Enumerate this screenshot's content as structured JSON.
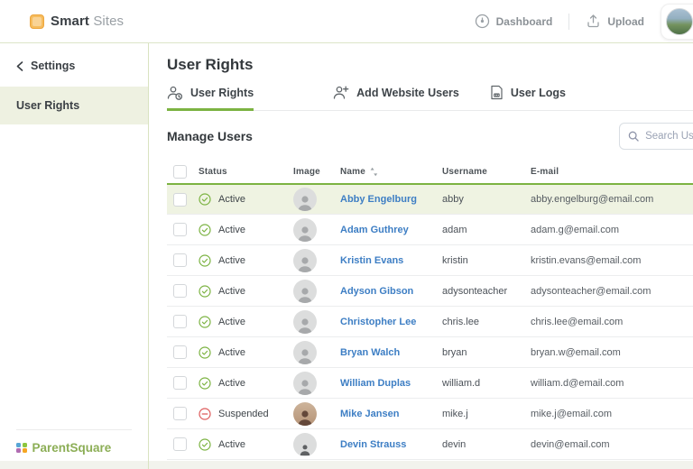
{
  "colors": {
    "accent_green": "#7cb342",
    "link_blue": "#3d7ec4",
    "suspended_red": "#dd5b5b",
    "brand_orange": "#f6bc5d",
    "parentsquare_green": "#8cae56",
    "selected_row_bg": "#eff3e2"
  },
  "topbar": {
    "brand_bold": "Smart",
    "brand_light": "Sites",
    "dashboard_label": "Dashboard",
    "upload_label": "Upload"
  },
  "sidebar": {
    "back_label": "Settings",
    "items": [
      {
        "label": "User Rights",
        "active": true
      }
    ],
    "footer_brand": "ParentSquare"
  },
  "main": {
    "page_title": "User Rights",
    "tabs": [
      {
        "label": "User Rights",
        "active": true
      },
      {
        "label": "Add Website Users",
        "active": false
      },
      {
        "label": "User Logs",
        "active": false
      }
    ],
    "section_title": "Manage Users",
    "search_placeholder": "Search User",
    "table": {
      "columns": [
        "Status",
        "Image",
        "Name",
        "Username",
        "E-mail"
      ],
      "rows": [
        {
          "selected": true,
          "status": "Active",
          "status_type": "active",
          "name": "Abby Engelburg",
          "username": "abby",
          "email": "abby.engelburg@email.com",
          "avatar": "gray"
        },
        {
          "selected": false,
          "status": "Active",
          "status_type": "active",
          "name": "Adam Guthrey",
          "username": "adam",
          "email": "adam.g@email.com",
          "avatar": "gray"
        },
        {
          "selected": false,
          "status": "Active",
          "status_type": "active",
          "name": "Kristin Evans",
          "username": "kristin",
          "email": "kristin.evans@email.com",
          "avatar": "gray"
        },
        {
          "selected": false,
          "status": "Active",
          "status_type": "active",
          "name": "Adyson Gibson",
          "username": "adysonteacher",
          "email": "adysonteacher@email.com",
          "avatar": "gray"
        },
        {
          "selected": false,
          "status": "Active",
          "status_type": "active",
          "name": "Christopher Lee",
          "username": "chris.lee",
          "email": "chris.lee@email.com",
          "avatar": "gray"
        },
        {
          "selected": false,
          "status": "Active",
          "status_type": "active",
          "name": "Bryan Walch",
          "username": "bryan",
          "email": "bryan.w@email.com",
          "avatar": "gray"
        },
        {
          "selected": false,
          "status": "Active",
          "status_type": "active",
          "name": "William Duplas",
          "username": "william.d",
          "email": "william.d@email.com",
          "avatar": "gray"
        },
        {
          "selected": false,
          "status": "Suspended",
          "status_type": "suspended",
          "name": "Mike Jansen",
          "username": "mike.j",
          "email": "mike.j@email.com",
          "avatar": "warm"
        },
        {
          "selected": false,
          "status": "Active",
          "status_type": "active",
          "name": "Devin Strauss",
          "username": "devin",
          "email": "devin@email.com",
          "avatar": "dark"
        }
      ]
    }
  }
}
